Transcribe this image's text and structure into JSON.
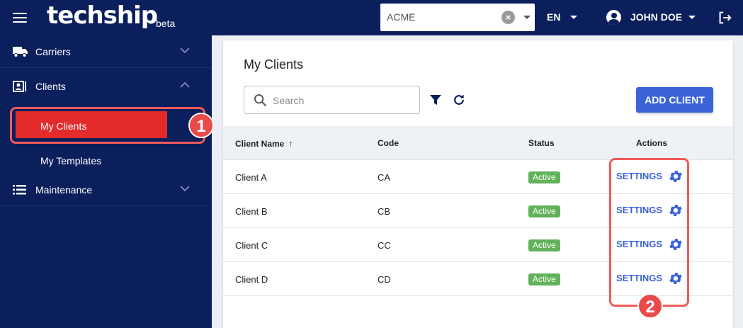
{
  "header": {
    "logo": "techship",
    "beta": "beta",
    "org_select": {
      "value": "ACME"
    },
    "language": "EN",
    "user_name": "JOHN DOE"
  },
  "sidebar": {
    "items": [
      {
        "label": "Carriers",
        "icon": "truck-icon"
      },
      {
        "label": "Clients",
        "icon": "contact-card-icon"
      },
      {
        "label": "Maintenance",
        "icon": "list-icon"
      }
    ],
    "sub_items": [
      {
        "label": "My Clients"
      },
      {
        "label": "My Templates"
      }
    ]
  },
  "callouts": [
    "1",
    "2"
  ],
  "main": {
    "title": "My Clients",
    "search_placeholder": "Search",
    "add_button": "ADD CLIENT",
    "columns": [
      "Client Name",
      "Code",
      "Status",
      "Actions"
    ],
    "rows": [
      {
        "name": "Client A",
        "code": "CA",
        "status": "Active",
        "action": "SETTINGS"
      },
      {
        "name": "Client B",
        "code": "CB",
        "status": "Active",
        "action": "SETTINGS"
      },
      {
        "name": "Client C",
        "code": "CC",
        "status": "Active",
        "action": "SETTINGS"
      },
      {
        "name": "Client D",
        "code": "CD",
        "status": "Active",
        "action": "SETTINGS"
      }
    ]
  },
  "colors": {
    "header_bg": "#0b1f5c",
    "active_item": "#e32b2b",
    "primary": "#3b63d8",
    "status_active": "#62b25c",
    "callout": "#f05a5a"
  }
}
